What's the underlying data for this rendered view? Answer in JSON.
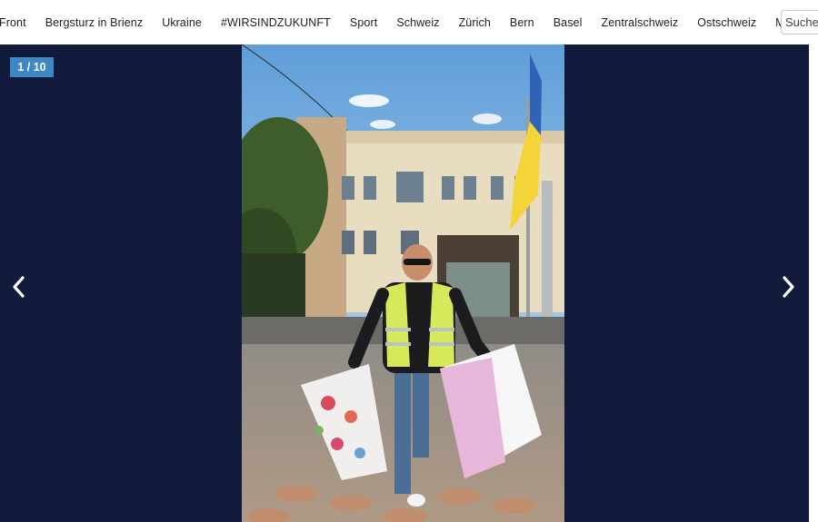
{
  "nav": {
    "items": [
      "Front",
      "Bergsturz in Brienz",
      "Ukraine",
      "#WIRSINDZUKUNFT",
      "Sport",
      "Schweiz",
      "Zürich",
      "Bern",
      "Basel",
      "Zentralschweiz",
      "Ostschweiz",
      "M"
    ],
    "search_placeholder": "Suche"
  },
  "gallery": {
    "counter": "1 / 10",
    "prev_icon": "chevron-left-icon",
    "next_icon": "chevron-right-icon",
    "photo": "photo"
  },
  "colors": {
    "gallery_bg": "#111a3b",
    "counter_bg": "#3c87c4",
    "vest": "#d7e85a",
    "flag_blue": "#2e63b8",
    "flag_yellow": "#f3d53a"
  }
}
